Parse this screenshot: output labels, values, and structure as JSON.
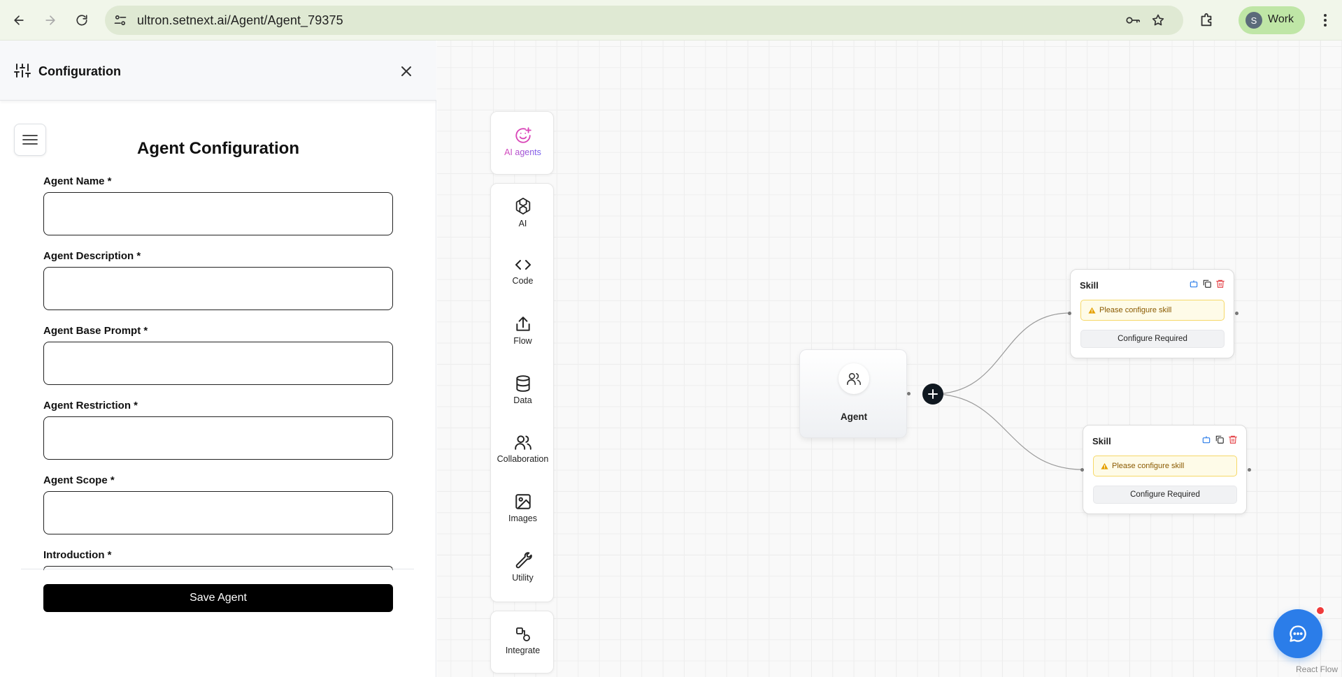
{
  "browser": {
    "url": "ultron.setnext.ai/Agent/Agent_79375",
    "profile_initial": "S",
    "profile_name": "Work"
  },
  "panel": {
    "title": "Configuration",
    "form_title": "Agent Configuration",
    "fields": [
      {
        "label": "Agent Name *",
        "value": ""
      },
      {
        "label": "Agent Description *",
        "value": ""
      },
      {
        "label": "Agent Base Prompt *",
        "value": ""
      },
      {
        "label": "Agent Restriction *",
        "value": ""
      },
      {
        "label": "Agent Scope *",
        "value": ""
      },
      {
        "label": "Introduction *",
        "value": ""
      }
    ],
    "save_label": "Save Agent"
  },
  "palette": {
    "featured": {
      "label": "AI agents",
      "icon": "smile-plus-icon"
    },
    "tools": [
      {
        "label": "AI",
        "icon": "openai-icon"
      },
      {
        "label": "Code",
        "icon": "code-icon"
      },
      {
        "label": "Flow",
        "icon": "share-icon"
      },
      {
        "label": "Data",
        "icon": "database-icon"
      },
      {
        "label": "Collaboration",
        "icon": "users-icon"
      },
      {
        "label": "Images",
        "icon": "image-icon"
      },
      {
        "label": "Utility",
        "icon": "wrench-icon"
      }
    ],
    "integrate": {
      "label": "Integrate",
      "icon": "integrate-icon"
    }
  },
  "canvas": {
    "agent_node": {
      "label": "Agent"
    },
    "skills": [
      {
        "title": "Skill",
        "warning": "Please configure skill",
        "config_label": "Configure Required"
      },
      {
        "title": "Skill",
        "warning": "Please configure skill",
        "config_label": "Configure Required"
      }
    ],
    "attribution": "React Flow"
  },
  "colors": {
    "accent_blue": "#2b7de9",
    "warning_bg": "#fefbe8",
    "warning_border": "#f6d868",
    "delete_red": "#e5484d",
    "save_bg": "#000000"
  }
}
